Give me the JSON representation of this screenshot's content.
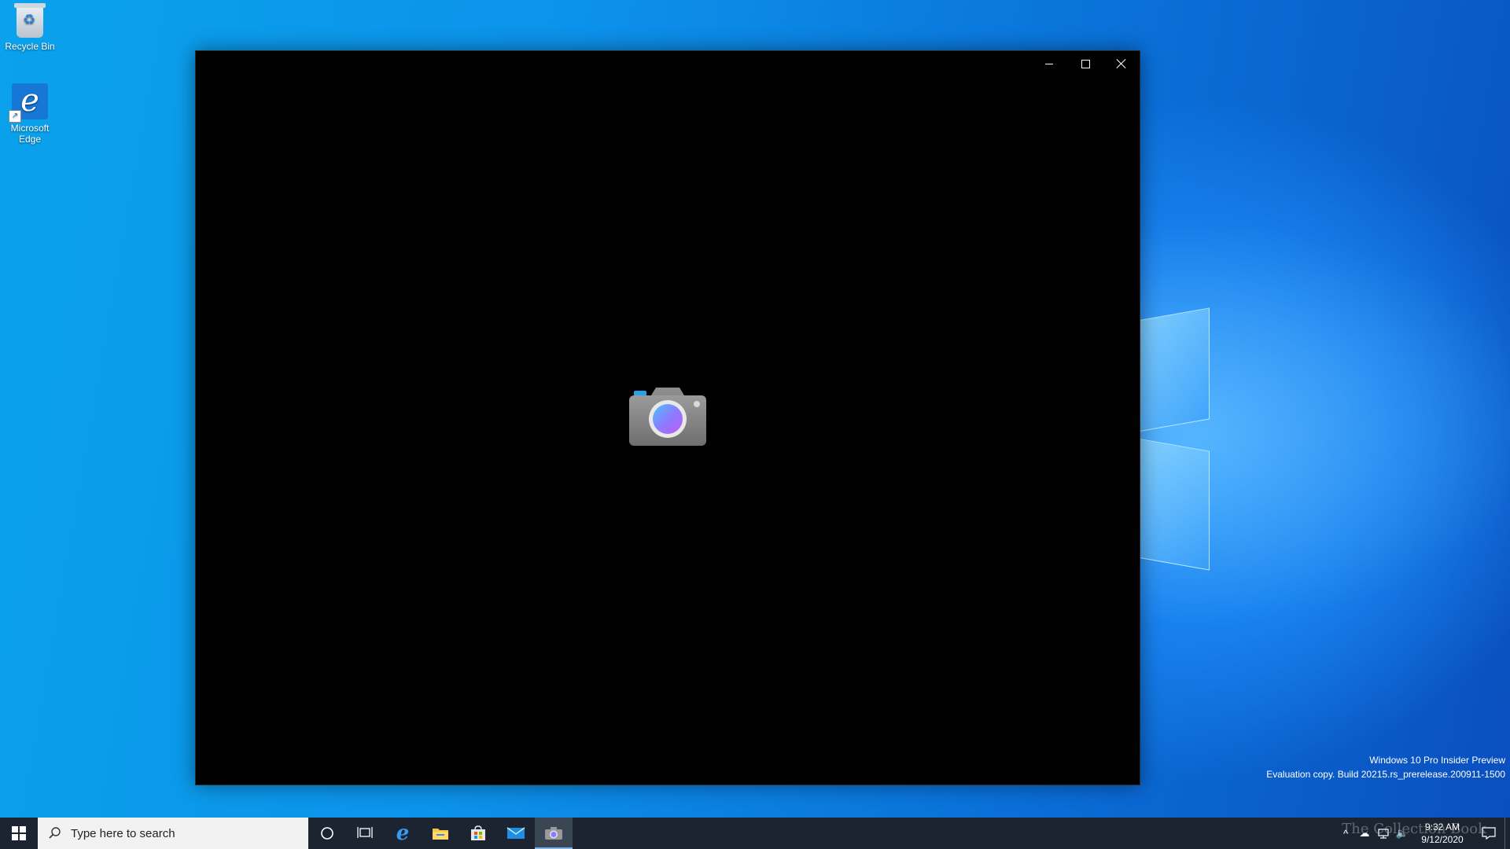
{
  "desktop": {
    "icons": [
      {
        "label": "Recycle Bin",
        "icon": "recycle-bin-icon"
      },
      {
        "label": "Microsoft Edge",
        "icon": "edge-icon"
      }
    ]
  },
  "window": {
    "app": "Camera",
    "splash_icon": "camera-icon",
    "buttons": {
      "minimize": "minimize-icon",
      "maximize": "maximize-icon",
      "close": "close-icon"
    }
  },
  "watermark": {
    "line1": "Windows 10 Pro Insider Preview",
    "line2": "Evaluation copy. Build 20215.rs_prerelease.200911-1500"
  },
  "taskbar": {
    "search_placeholder": "Type here to search",
    "pinned": [
      {
        "name": "cortana",
        "icon": "cortana-circle-icon"
      },
      {
        "name": "task-view",
        "icon": "task-view-icon"
      },
      {
        "name": "edge",
        "icon": "edge-icon"
      },
      {
        "name": "file-explorer",
        "icon": "folder-icon"
      },
      {
        "name": "store",
        "icon": "store-bag-icon"
      },
      {
        "name": "mail",
        "icon": "mail-icon"
      },
      {
        "name": "camera",
        "icon": "camera-icon",
        "active": true
      }
    ],
    "tray": {
      "time": "9:32 AM",
      "date": "9/12/2020",
      "brand_overlay": "The Collection Book"
    }
  }
}
